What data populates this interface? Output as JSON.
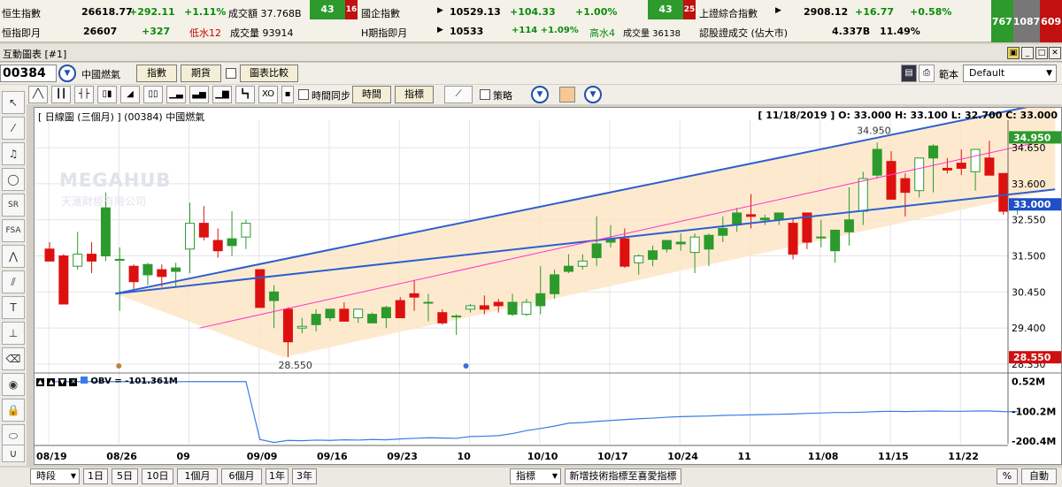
{
  "ticker": {
    "row1": {
      "hsi_label": "恒生指數",
      "hsi_value": "26618.77",
      "hsi_change": "+292.11",
      "hsi_pct": "+1.11%",
      "hsi_turnover": "成交額 37.768B",
      "adv": "43",
      "dec": "16",
      "hscei_label": "國企指數",
      "hscei_value": "10529.13",
      "hscei_change": "+104.33",
      "hscei_pct": "+1.00%",
      "adv2": "43",
      "dec2": "25",
      "sse_label": "上證綜合指數",
      "sse_value": "2908.12",
      "sse_change": "+16.77",
      "sse_pct": "+0.58%"
    },
    "row2": {
      "hsif_label": "恒指即月",
      "hsif_value": "26607",
      "hsif_change": "+327",
      "hsif_discount": "低水12",
      "hsif_volume": "成交量 93914",
      "hf_label": "H期指即月",
      "hf_value": "10533",
      "hf_change": "+114 +1.09%",
      "hf_premium": "高水4",
      "hf_volume": "成交量 36138",
      "ah_label": "認股證成交 (佔大市)",
      "ah_value": "4.337B",
      "ah_pct": "11.49%"
    },
    "breadth": [
      "767",
      "1087",
      "609"
    ]
  },
  "window": {
    "title": "互動圖表 [#1]"
  },
  "toolbar": {
    "stock_code": "00384",
    "stock_name": "中國燃氣",
    "btn_index": "指數",
    "btn_futures": "期貨",
    "btn_compare": "圖表比較",
    "layout_label": "範本",
    "layout_value": "Default"
  },
  "toolbar2": {
    "sync_label": "時間同步",
    "btn_time": "時間",
    "btn_indicator": "指標",
    "strategy_label": "策略"
  },
  "chart_header": {
    "title": "[ 日線圖 (三個月) ]  (00384)  中國燃氣",
    "ohlc": "[ 11/18/2019 ]  O: 33.000  H: 33.100  L: 32.700  C: 33.000"
  },
  "watermark": {
    "line1": "MEGAHUB",
    "line2": "天滙財經有限公司"
  },
  "obv_label": "OBV = -101.361M",
  "colors": {
    "up": "#2c9a2c",
    "down": "#dd1010",
    "channel": "#2d5fd0",
    "mid": "#ff33cc",
    "fill": "#fde6c6"
  },
  "chart_data": {
    "type": "candlestick",
    "ylim": [
      28.35,
      35.45
    ],
    "y_ticks": [
      "34.650",
      "33.600",
      "32.550",
      "31.500",
      "30.450",
      "29.400",
      "28.350"
    ],
    "y_tick_values": [
      34.65,
      33.6,
      32.55,
      31.5,
      30.45,
      29.4,
      28.35
    ],
    "price_labels": {
      "high": "34.950",
      "low": "28.550",
      "last": "33.000",
      "right_high": "34.950",
      "right_low": "28.550"
    },
    "x_labels": [
      "08/19",
      "08/26",
      "09",
      "09/09",
      "09/16",
      "09/23",
      "10",
      "10/10",
      "10/17",
      "10/24",
      "11",
      "11/08",
      "11/15",
      "11/22"
    ],
    "x_label_index": [
      0,
      5,
      10,
      15,
      20,
      25,
      30,
      35,
      40,
      45,
      50,
      55,
      60,
      65
    ],
    "candles": [
      {
        "o": 31.7,
        "h": 31.9,
        "l": 31.35,
        "c": 31.35
      },
      {
        "o": 31.5,
        "h": 31.55,
        "l": 30.1,
        "c": 30.1
      },
      {
        "o": 31.2,
        "h": 32.2,
        "l": 31.1,
        "c": 31.55
      },
      {
        "o": 31.55,
        "h": 31.9,
        "l": 31.0,
        "c": 31.35
      },
      {
        "o": 31.5,
        "h": 33.35,
        "l": 31.35,
        "c": 32.9
      },
      {
        "o": 31.4,
        "h": 31.75,
        "l": 29.9,
        "c": 31.4
      },
      {
        "o": 31.2,
        "h": 31.25,
        "l": 30.45,
        "c": 30.75
      },
      {
        "o": 30.95,
        "h": 31.3,
        "l": 30.65,
        "c": 31.25
      },
      {
        "o": 31.1,
        "h": 31.25,
        "l": 30.6,
        "c": 30.9
      },
      {
        "o": 31.05,
        "h": 31.3,
        "l": 30.6,
        "c": 31.15
      },
      {
        "o": 31.7,
        "h": 33.05,
        "l": 31.0,
        "c": 32.45
      },
      {
        "o": 32.45,
        "h": 32.95,
        "l": 31.95,
        "c": 32.05
      },
      {
        "o": 31.95,
        "h": 32.3,
        "l": 31.45,
        "c": 31.65
      },
      {
        "o": 31.8,
        "h": 32.8,
        "l": 31.5,
        "c": 32.0
      },
      {
        "o": 32.05,
        "h": 32.55,
        "l": 31.7,
        "c": 32.45
      },
      {
        "o": 31.1,
        "h": 31.1,
        "l": 30.0,
        "c": 30.0
      },
      {
        "o": 30.2,
        "h": 30.65,
        "l": 29.4,
        "c": 30.45
      },
      {
        "o": 29.95,
        "h": 30.0,
        "l": 28.55,
        "c": 29.0
      },
      {
        "o": 29.4,
        "h": 29.7,
        "l": 29.25,
        "c": 29.45
      },
      {
        "o": 29.5,
        "h": 29.95,
        "l": 29.3,
        "c": 29.8
      },
      {
        "o": 29.7,
        "h": 29.95,
        "l": 29.6,
        "c": 29.95
      },
      {
        "o": 29.95,
        "h": 30.15,
        "l": 29.6,
        "c": 29.6
      },
      {
        "o": 29.7,
        "h": 29.95,
        "l": 29.55,
        "c": 29.95
      },
      {
        "o": 29.55,
        "h": 29.85,
        "l": 29.55,
        "c": 29.8
      },
      {
        "o": 29.7,
        "h": 30.05,
        "l": 29.4,
        "c": 30.0
      },
      {
        "o": 30.2,
        "h": 30.3,
        "l": 29.7,
        "c": 29.7
      },
      {
        "o": 30.4,
        "h": 30.8,
        "l": 29.9,
        "c": 30.3
      },
      {
        "o": 30.15,
        "h": 30.4,
        "l": 29.6,
        "c": 30.15
      },
      {
        "o": 29.85,
        "h": 29.95,
        "l": 29.5,
        "c": 29.55
      },
      {
        "o": 29.75,
        "h": 29.8,
        "l": 29.2,
        "c": 29.75
      },
      {
        "o": 29.95,
        "h": 30.1,
        "l": 29.85,
        "c": 30.05
      },
      {
        "o": 30.05,
        "h": 30.35,
        "l": 29.8,
        "c": 29.95
      },
      {
        "o": 30.15,
        "h": 30.25,
        "l": 29.85,
        "c": 30.05
      },
      {
        "o": 29.8,
        "h": 30.4,
        "l": 29.75,
        "c": 30.15
      },
      {
        "o": 29.8,
        "h": 30.25,
        "l": 29.75,
        "c": 30.15
      },
      {
        "o": 30.05,
        "h": 31.2,
        "l": 29.8,
        "c": 30.4
      },
      {
        "o": 30.4,
        "h": 31.1,
        "l": 30.25,
        "c": 30.95
      },
      {
        "o": 31.05,
        "h": 31.55,
        "l": 31.0,
        "c": 31.2
      },
      {
        "o": 31.2,
        "h": 31.55,
        "l": 31.1,
        "c": 31.35
      },
      {
        "o": 31.45,
        "h": 32.65,
        "l": 31.2,
        "c": 31.85
      },
      {
        "o": 31.9,
        "h": 32.4,
        "l": 31.75,
        "c": 32.0
      },
      {
        "o": 32.0,
        "h": 32.3,
        "l": 31.15,
        "c": 31.2
      },
      {
        "o": 31.3,
        "h": 31.55,
        "l": 30.95,
        "c": 31.5
      },
      {
        "o": 31.4,
        "h": 31.8,
        "l": 31.2,
        "c": 31.65
      },
      {
        "o": 31.7,
        "h": 31.95,
        "l": 31.6,
        "c": 31.95
      },
      {
        "o": 31.85,
        "h": 32.15,
        "l": 31.65,
        "c": 31.9
      },
      {
        "o": 31.6,
        "h": 32.15,
        "l": 31.0,
        "c": 32.05
      },
      {
        "o": 31.7,
        "h": 32.15,
        "l": 31.2,
        "c": 32.1
      },
      {
        "o": 32.1,
        "h": 32.65,
        "l": 31.9,
        "c": 32.3
      },
      {
        "o": 32.4,
        "h": 32.9,
        "l": 32.2,
        "c": 32.75
      },
      {
        "o": 32.7,
        "h": 33.3,
        "l": 32.3,
        "c": 32.65
      },
      {
        "o": 32.55,
        "h": 32.7,
        "l": 32.4,
        "c": 32.6
      },
      {
        "o": 32.55,
        "h": 32.75,
        "l": 32.4,
        "c": 32.75
      },
      {
        "o": 32.45,
        "h": 32.6,
        "l": 31.4,
        "c": 31.55
      },
      {
        "o": 32.75,
        "h": 32.75,
        "l": 31.7,
        "c": 31.9
      },
      {
        "o": 32.05,
        "h": 32.55,
        "l": 31.75,
        "c": 32.05
      },
      {
        "o": 31.65,
        "h": 32.25,
        "l": 31.3,
        "c": 32.25
      },
      {
        "o": 32.2,
        "h": 33.5,
        "l": 31.8,
        "c": 32.55
      },
      {
        "o": 32.8,
        "h": 33.95,
        "l": 32.4,
        "c": 33.75
      },
      {
        "o": 33.85,
        "h": 34.8,
        "l": 33.75,
        "c": 34.6
      },
      {
        "o": 34.25,
        "h": 34.55,
        "l": 33.15,
        "c": 33.15
      },
      {
        "o": 33.75,
        "h": 33.9,
        "l": 32.65,
        "c": 33.35
      },
      {
        "o": 33.4,
        "h": 34.35,
        "l": 33.2,
        "c": 34.35
      },
      {
        "o": 34.35,
        "h": 34.75,
        "l": 33.35,
        "c": 34.7
      },
      {
        "o": 34.05,
        "h": 34.35,
        "l": 33.9,
        "c": 34.0
      },
      {
        "o": 34.2,
        "h": 34.6,
        "l": 33.85,
        "c": 34.05
      },
      {
        "o": 33.95,
        "h": 34.6,
        "l": 33.4,
        "c": 34.6
      },
      {
        "o": 34.35,
        "h": 34.85,
        "l": 33.9,
        "c": 33.85
      },
      {
        "o": 33.9,
        "h": 33.9,
        "l": 32.7,
        "c": 32.8
      },
      {
        "o": 33.0,
        "h": 33.1,
        "l": 32.7,
        "c": 33.0
      }
    ],
    "channel": {
      "lower": [
        [
          5,
          30.4
        ],
        [
          69,
          33.3
        ]
      ],
      "upper": [
        [
          5,
          30.4
        ],
        [
          69,
          35.75
        ]
      ],
      "mid": [
        [
          11,
          29.4
        ],
        [
          69,
          34.65
        ]
      ]
    },
    "obv": {
      "y_ticks": [
        "0.52M",
        "-100.2M",
        "-200.4M"
      ],
      "ylim": [
        -215,
        5
      ],
      "values": [
        -0.5,
        -0.4,
        -0.3,
        -0.3,
        -0.2,
        -0.2,
        -0.3,
        -0.4,
        -0.4,
        -0.4,
        -0.3,
        -0.3,
        -0.3,
        -0.2,
        -0.3,
        -195,
        -205,
        -198,
        -199,
        -197,
        -198,
        -196,
        -197,
        -195,
        -196,
        -193,
        -191,
        -189,
        -190,
        -191,
        -185,
        -184,
        -182,
        -175,
        -165,
        -158,
        -150,
        -140,
        -138,
        -134,
        -131,
        -128,
        -125,
        -123,
        -120,
        -118,
        -117,
        -116,
        -114,
        -113,
        -112,
        -111,
        -110,
        -109,
        -107,
        -106,
        -104,
        -104,
        -103,
        -101,
        -100,
        -101,
        -100,
        -99,
        -100,
        -100,
        -99,
        -99,
        -101,
        -101.4
      ]
    }
  },
  "bottom_bar": {
    "period_select": "時段",
    "periods": [
      "1日",
      "5日",
      "10日",
      "1個月",
      "6個月",
      "1年",
      "3年"
    ],
    "indicator_select": "指標",
    "add_indicator": "新增技術指標至喜愛指標",
    "pct": "%",
    "auto": "自動"
  }
}
